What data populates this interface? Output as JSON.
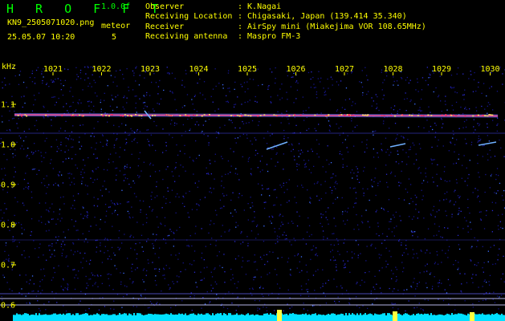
{
  "header": {
    "app_title": "H R O F F T",
    "version": "1.0.0f",
    "filename": "KN9_2505071020.png",
    "mode": "meteor",
    "timestamp": "25.05.07 10:20",
    "count": "5",
    "info": [
      {
        "label": "Observer",
        "value": ": K.Nagai"
      },
      {
        "label": "Receiving Location",
        "value": ": Chigasaki, Japan (139.414 35.340)"
      },
      {
        "label": "Receiver",
        "value": ": AirSpy mini (Miakejima VOR 108.65MHz)"
      },
      {
        "label": "Receiving antenna",
        "value": ": Maspro FM-3"
      }
    ]
  },
  "plot": {
    "y_unit": "kHz",
    "x_ticks": [
      "1021",
      "1022",
      "1023",
      "1024",
      "1025",
      "1026",
      "1027",
      "1028",
      "1029",
      "1030"
    ],
    "y_ticks": [
      "1.1",
      "1.0",
      "0.9",
      "0.8",
      "0.7",
      "0.6"
    ],
    "colors": {
      "background": "#000000",
      "noise": "#1a1aa0",
      "carrier": "#ff5599",
      "baseline": "#00e0ff",
      "label": "#ffff00"
    }
  }
}
